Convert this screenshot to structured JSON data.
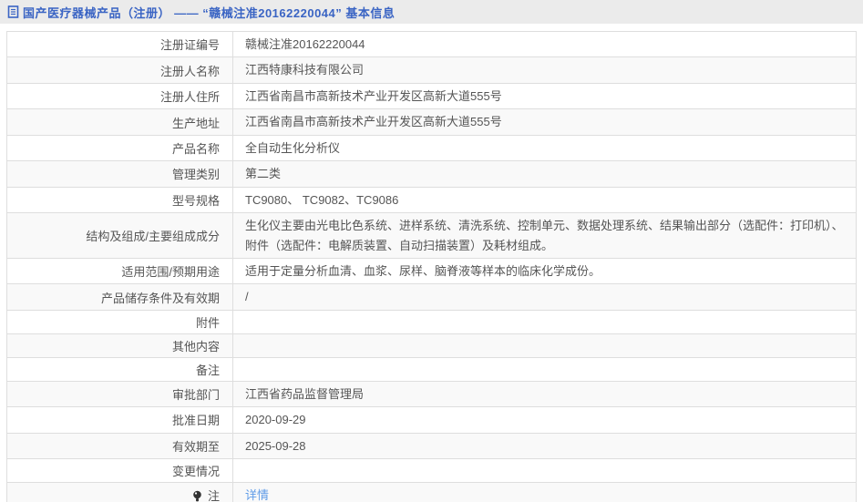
{
  "page": {
    "title": "国产医疗器械产品（注册） ——  “赣械注准20162220044”  基本信息"
  },
  "icons": {
    "title_icon": "document-icon",
    "note_row_icon": "note-bulb-icon"
  },
  "colors": {
    "title_bar_bg": "#ebebeb",
    "title_text": "#3a64c4",
    "link_blue": "#5f9ce8",
    "row_alt_bg": "#f9f9f9",
    "border": "#dedede",
    "text": "#555555"
  },
  "table": {
    "rows": [
      {
        "label": "注册证编号",
        "value": "赣械注准20162220044"
      },
      {
        "label": "注册人名称",
        "value": "江西特康科技有限公司"
      },
      {
        "label": "注册人住所",
        "value": "江西省南昌市高新技术产业开发区高新大道555号"
      },
      {
        "label": "生产地址",
        "value": "江西省南昌市高新技术产业开发区高新大道555号"
      },
      {
        "label": "产品名称",
        "value": "全自动生化分析仪"
      },
      {
        "label": "管理类别",
        "value": "第二类"
      },
      {
        "label": "型号规格",
        "value": "TC9080、 TC9082、TC9086"
      },
      {
        "label": "结构及组成/主要组成成分",
        "value": "生化仪主要由光电比色系统、进样系统、清洗系统、控制单元、数据处理系统、结果输出部分（选配件：打印机）、附件（选配件：电解质装置、自动扫描装置）及耗材组成。"
      },
      {
        "label": "适用范围/预期用途",
        "value": "适用于定量分析血清、血浆、尿样、脑脊液等样本的临床化学成份。"
      },
      {
        "label": "产品储存条件及有效期",
        "value": "/"
      },
      {
        "label": "附件",
        "value": ""
      },
      {
        "label": "其他内容",
        "value": ""
      },
      {
        "label": "备注",
        "value": ""
      },
      {
        "label": "审批部门",
        "value": "江西省药品监督管理局"
      },
      {
        "label": "批准日期",
        "value": "2020-09-29"
      },
      {
        "label": "有效期至",
        "value": "2025-09-28"
      },
      {
        "label": "变更情况",
        "value": ""
      },
      {
        "label": "注",
        "value": "详情",
        "value_is_link": true,
        "label_has_icon": true
      }
    ]
  }
}
